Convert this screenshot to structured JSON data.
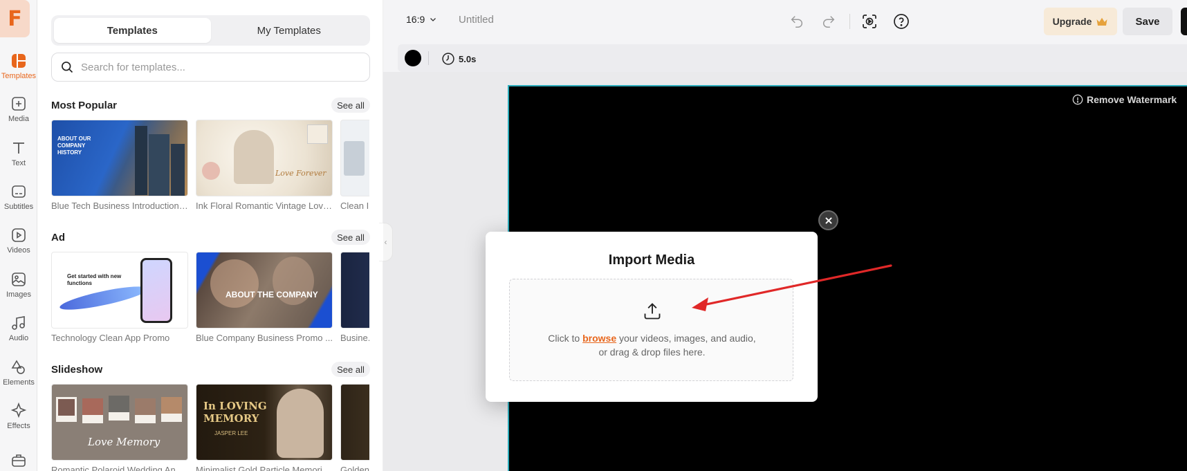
{
  "app": {
    "logo_letter": "F",
    "brand_color": "#e8661c"
  },
  "rail": {
    "items": [
      {
        "label": "Templates",
        "icon": "templates-icon"
      },
      {
        "label": "Media",
        "icon": "media-icon"
      },
      {
        "label": "Text",
        "icon": "text-icon"
      },
      {
        "label": "Subtitles",
        "icon": "subtitles-icon"
      },
      {
        "label": "Videos",
        "icon": "videos-icon"
      },
      {
        "label": "Images",
        "icon": "images-icon"
      },
      {
        "label": "Audio",
        "icon": "audio-icon"
      },
      {
        "label": "Elements",
        "icon": "elements-icon"
      },
      {
        "label": "Effects",
        "icon": "effects-icon"
      },
      {
        "label": "",
        "icon": "briefcase-icon"
      }
    ]
  },
  "panel": {
    "tabs": [
      "Templates",
      "My Templates"
    ],
    "search_placeholder": "Search for templates...",
    "see_all": "See all",
    "sections": [
      {
        "title": "Most Popular",
        "cards": [
          "Blue Tech Business Introduction ...",
          "Ink Floral Romantic Vintage Love...",
          "Clean I..."
        ]
      },
      {
        "title": "Ad",
        "cards": [
          "Technology Clean App Promo",
          "Blue Company Business Promo ...",
          "Busine..."
        ]
      },
      {
        "title": "Slideshow",
        "cards": [
          "Romantic Polaroid Wedding Anni...",
          "Minimalist Gold Particle Memori...",
          "Golden..."
        ]
      }
    ],
    "thumb_text": {
      "about_company_history": "ABOUT OUR COMPANY HISTORY",
      "love_forever": "Love Forever",
      "get_started": "Get started with new functions",
      "about_the_company": "ABOUT THE COMPANY",
      "love_memory": "Love Memory",
      "loving_memory": "In LOVING MEMORY",
      "jasper": "JASPER LEE"
    }
  },
  "topbar": {
    "ratio": "16:9",
    "title": "Untitled",
    "upgrade": "Upgrade",
    "save": "Save"
  },
  "canvas_toolbar": {
    "duration": "5.0s",
    "bg_color": "#000000"
  },
  "canvas": {
    "watermark": "Remove Watermark"
  },
  "modal": {
    "title": "Import Media",
    "line1_prefix": "Click to",
    "browse": "browse",
    "line1_suffix": "your videos, images, and audio,",
    "line2": "or drag & drop files here."
  }
}
